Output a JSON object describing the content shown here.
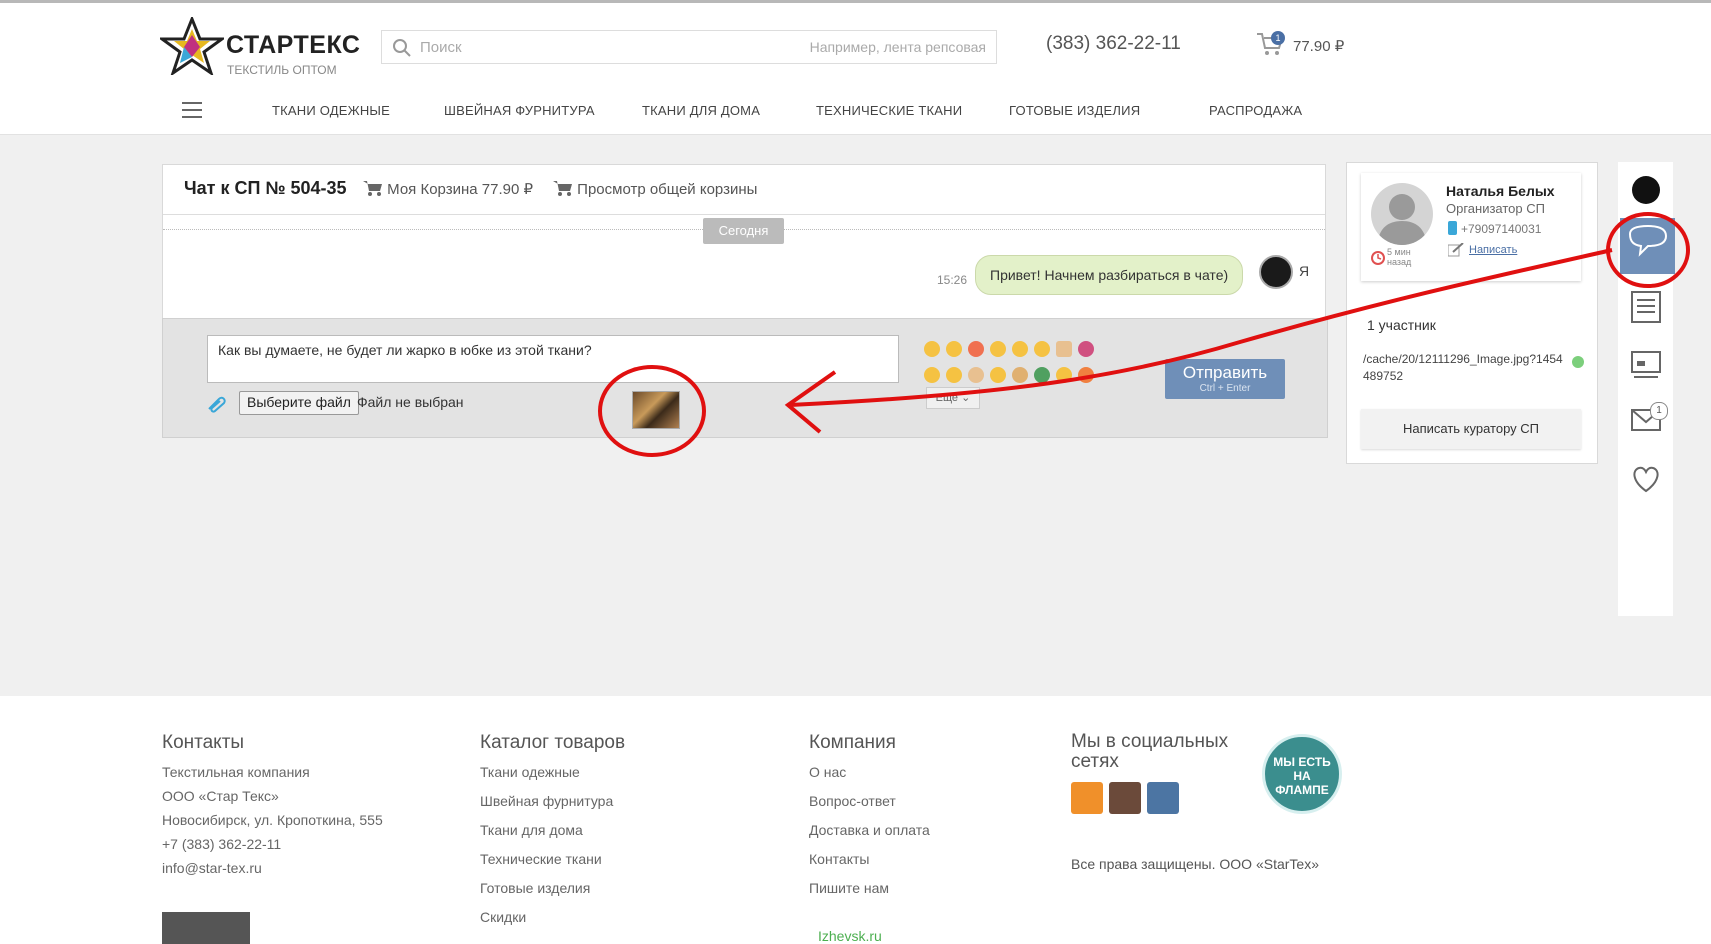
{
  "header": {
    "logo_name": "СТАРТЕКС",
    "logo_sub": "ТЕКСТИЛЬ ОПТОМ",
    "search_placeholder": "Поиск",
    "search_hint": "Например, лента репсовая",
    "phone": "(383) 362-22-11",
    "cart_count": "1",
    "cart_total": "77.90 ₽"
  },
  "nav": {
    "items": [
      "ТКАНИ ОДЕЖНЫЕ",
      "ШВЕЙНАЯ ФУРНИТУРА",
      "ТКАНИ ДЛЯ ДОМА",
      "ТЕХНИЧЕСКИЕ ТКАНИ",
      "ГОТОВЫЕ ИЗДЕЛИЯ",
      "РАСПРОДАЖА"
    ]
  },
  "chat": {
    "title": "Чат к СП № 504-35",
    "my_cart": "Моя Корзина 77.90 ₽",
    "common_cart": "Просмотр общей корзины",
    "date_divider": "Сегодня",
    "message_time": "15:26",
    "message_text": "Привет! Начнем разбираться в чате)",
    "sender_label": "Я",
    "draft_text": "Как вы думаете, не будет ли жарко в юбке из этой ткани?",
    "file_button": "Выберите файл",
    "file_status": "Файл не выбран",
    "more_label": "Еще",
    "send_label": "Отправить",
    "send_hint": "Ctrl + Enter"
  },
  "profile": {
    "name": "Наталья Белых",
    "role": "Организатор СП",
    "phone": "+79097140031",
    "write_link": "Написать",
    "last_seen": "5 мин назад",
    "participants": "1 участник",
    "file_path": "/cache/20/12111296_Image.jpg?1454489752",
    "curator_button": "Написать куратору СП"
  },
  "sidebar": {
    "mail_badge": "1"
  },
  "footer": {
    "contacts_head": "Контакты",
    "contacts": [
      "Текстильная компания",
      "ООО «Стар Текс»",
      "Новосибирск, ул. Кропоткина, 555",
      "+7 (383) 362-22-11",
      "info@star-tex.ru"
    ],
    "catalog_head": "Каталог товаров",
    "catalog": [
      "Ткани одежные",
      "Швейная фурнитура",
      "Ткани для дома",
      "Технические ткани",
      "Готовые изделия",
      "Скидки"
    ],
    "company_head": "Компания",
    "company": [
      "О нас",
      "Вопрос-ответ",
      "Доставка и оплата",
      "Контакты",
      "Пишите нам"
    ],
    "social_head": "Мы в социальных сетях",
    "flamp": "МЫ ЕСТЬ НА ФЛАМПЕ",
    "copyright": "Все права защищены. ООО «StarTex»",
    "izhevsk": "Izhevsk.ru"
  },
  "colors": {
    "accent": "#6f8fb8",
    "annotation": "#e01010",
    "bubble": "#e3f1c9",
    "flamp": "#3b8e8e"
  }
}
